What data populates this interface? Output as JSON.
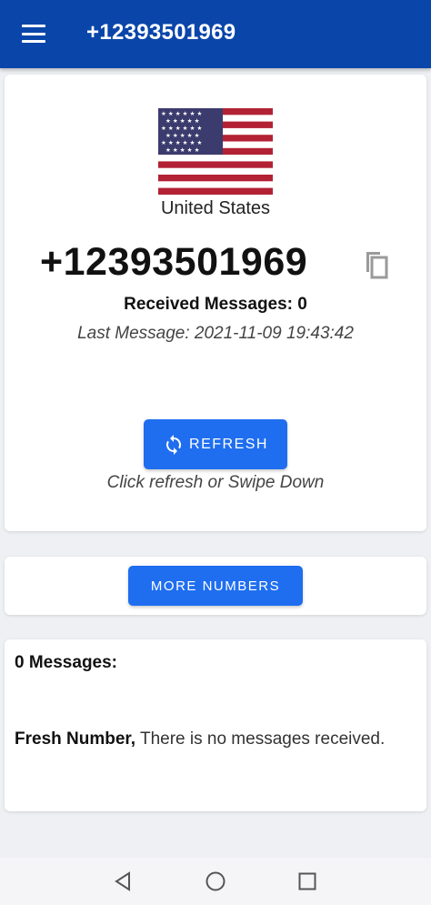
{
  "appbar": {
    "title": "+12393501969",
    "menu_icon": "hamburger-menu-icon",
    "background": "#0a46aa"
  },
  "main_card": {
    "flag_icon": "us-flag-icon",
    "country": "United States",
    "number": "+12393501969",
    "copy_icon": "copy-icon",
    "received_messages": "Received Messages: 0",
    "last_message": "Last Message: 2021-11-09 19:43:42",
    "refresh_label": "REFRESH",
    "refresh_icon": "refresh-icon",
    "hint": "Click refresh or Swipe Down"
  },
  "more": {
    "button_label": "MORE NUMBERS"
  },
  "messages": {
    "title": "0 Messages:",
    "fresh_bold": "Fresh Number,",
    "fresh_text": " There is no messages received."
  },
  "colors": {
    "accent": "#1f6ef0",
    "background": "#eef0f4"
  },
  "navbar": {
    "back_icon": "back-triangle-icon",
    "home_icon": "home-circle-icon",
    "recent_icon": "recent-square-icon"
  }
}
